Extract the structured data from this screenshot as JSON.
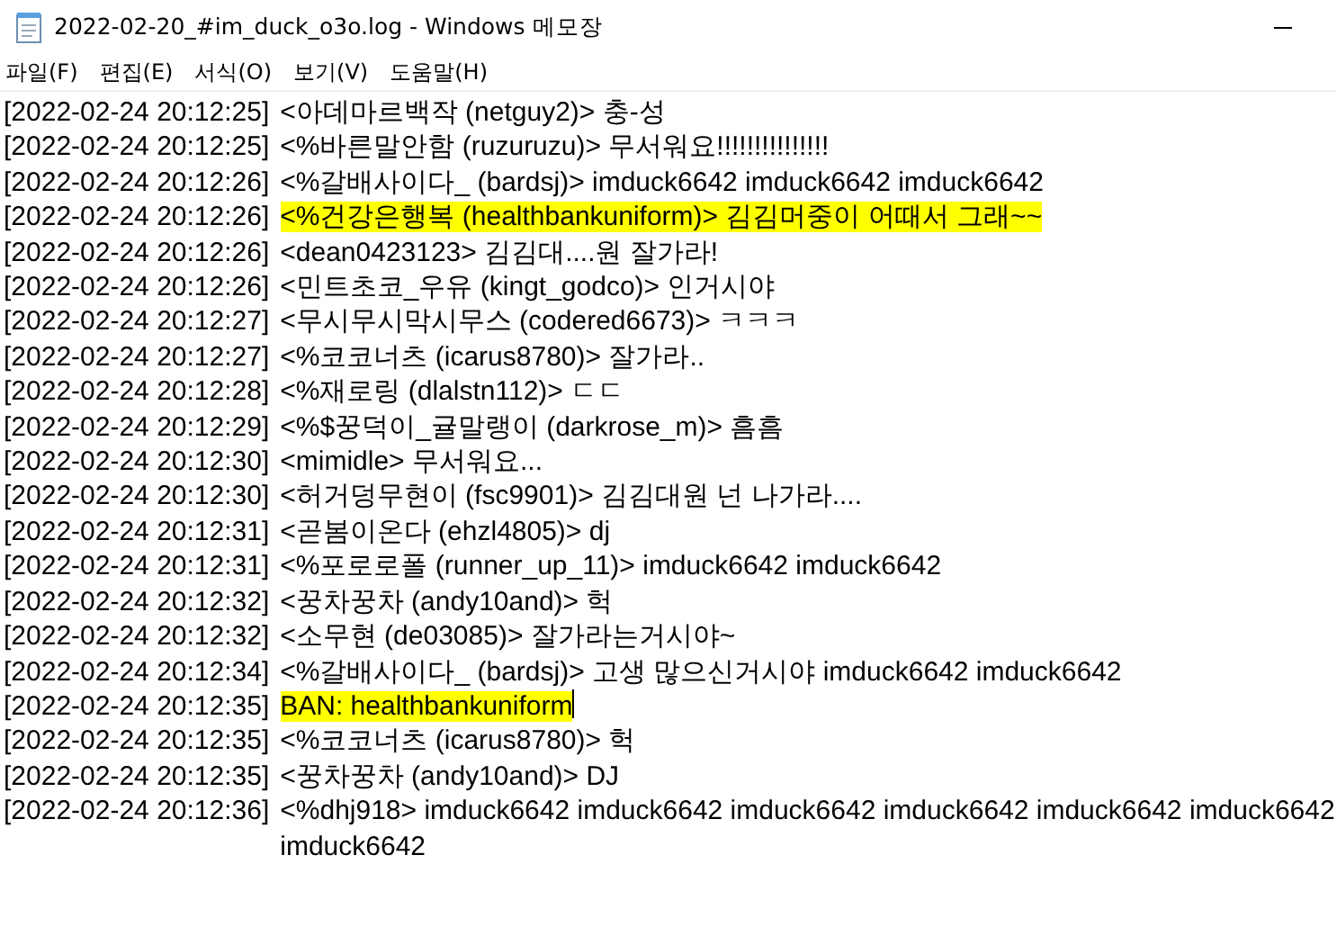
{
  "window": {
    "title": "2022-02-20_#im_duck_o3o.log - Windows 메모장"
  },
  "menu": [
    "파일(F)",
    "편집(E)",
    "서식(O)",
    "보기(V)",
    "도움말(H)"
  ],
  "lines": [
    {
      "time": "[2022-02-24 20:12:25]",
      "text": "<아데마르백작 (netguy2)> 충-성",
      "highlighted": false,
      "cursor": false
    },
    {
      "time": "[2022-02-24 20:12:25]",
      "text": "<%바른말안함 (ruzuruzu)> 무서워요!!!!!!!!!!!!!!!",
      "highlighted": false,
      "cursor": false
    },
    {
      "time": "[2022-02-24 20:12:26]",
      "text": "<%갈배사이다_ (bardsj)> imduck6642 imduck6642 imduck6642",
      "highlighted": false,
      "cursor": false
    },
    {
      "time": "[2022-02-24 20:12:26]",
      "text": "<%건강은행복 (healthbankuniform)> 김김머중이 어때서 그래~~",
      "highlighted": true,
      "cursor": false
    },
    {
      "time": "[2022-02-24 20:12:26]",
      "text": "<dean0423123> 김김대....원 잘가라!",
      "highlighted": false,
      "cursor": false
    },
    {
      "time": "[2022-02-24 20:12:26]",
      "text": "<민트초코_우유 (kingt_godco)> 인거시야",
      "highlighted": false,
      "cursor": false
    },
    {
      "time": "[2022-02-24 20:12:27]",
      "text": "<무시무시막시무스 (codered6673)> ㅋㅋㅋ",
      "highlighted": false,
      "cursor": false
    },
    {
      "time": "[2022-02-24 20:12:27]",
      "text": "<%코코너츠 (icarus8780)> 잘가라..",
      "highlighted": false,
      "cursor": false
    },
    {
      "time": "[2022-02-24 20:12:28]",
      "text": "<%재로링 (dlalstn112)> ㄷㄷ",
      "highlighted": false,
      "cursor": false
    },
    {
      "time": "[2022-02-24 20:12:29]",
      "text": "<%$꿍덕이_귤말랭이 (darkrose_m)> 흠흠",
      "highlighted": false,
      "cursor": false
    },
    {
      "time": "[2022-02-24 20:12:30]",
      "text": "<mimidle> 무서워요...",
      "highlighted": false,
      "cursor": false
    },
    {
      "time": "[2022-02-24 20:12:30]",
      "text": "<허거덩무현이 (fsc9901)> 김김대원 넌 나가라....",
      "highlighted": false,
      "cursor": false
    },
    {
      "time": "[2022-02-24 20:12:31]",
      "text": "<곧봄이온다 (ehzl4805)> dj",
      "highlighted": false,
      "cursor": false
    },
    {
      "time": "[2022-02-24 20:12:31]",
      "text": "<%포로로폴 (runner_up_11)> imduck6642 imduck6642",
      "highlighted": false,
      "cursor": false
    },
    {
      "time": "[2022-02-24 20:12:32]",
      "text": "<꿍차꿍차 (andy10and)> 헉",
      "highlighted": false,
      "cursor": false
    },
    {
      "time": "[2022-02-24 20:12:32]",
      "text": "<소무현 (de03085)> 잘가라는거시야~",
      "highlighted": false,
      "cursor": false
    },
    {
      "time": "[2022-02-24 20:12:34]",
      "text": "<%갈배사이다_ (bardsj)> 고생 많으신거시야 imduck6642 imduck6642",
      "highlighted": false,
      "cursor": false
    },
    {
      "time": "[2022-02-24 20:12:35]",
      "text": "BAN: healthbankuniform",
      "highlighted": true,
      "cursor": true
    },
    {
      "time": "[2022-02-24 20:12:35]",
      "text": "<%코코너츠 (icarus8780)> 헉",
      "highlighted": false,
      "cursor": false
    },
    {
      "time": "[2022-02-24 20:12:35]",
      "text": "<꿍차꿍차 (andy10and)> DJ",
      "highlighted": false,
      "cursor": false
    },
    {
      "time": "[2022-02-24 20:12:36]",
      "text": "<%dhj918> imduck6642 imduck6642 imduck6642 imduck6642 imduck6642 imduck6642 imduck6642",
      "highlighted": false,
      "cursor": false
    }
  ]
}
